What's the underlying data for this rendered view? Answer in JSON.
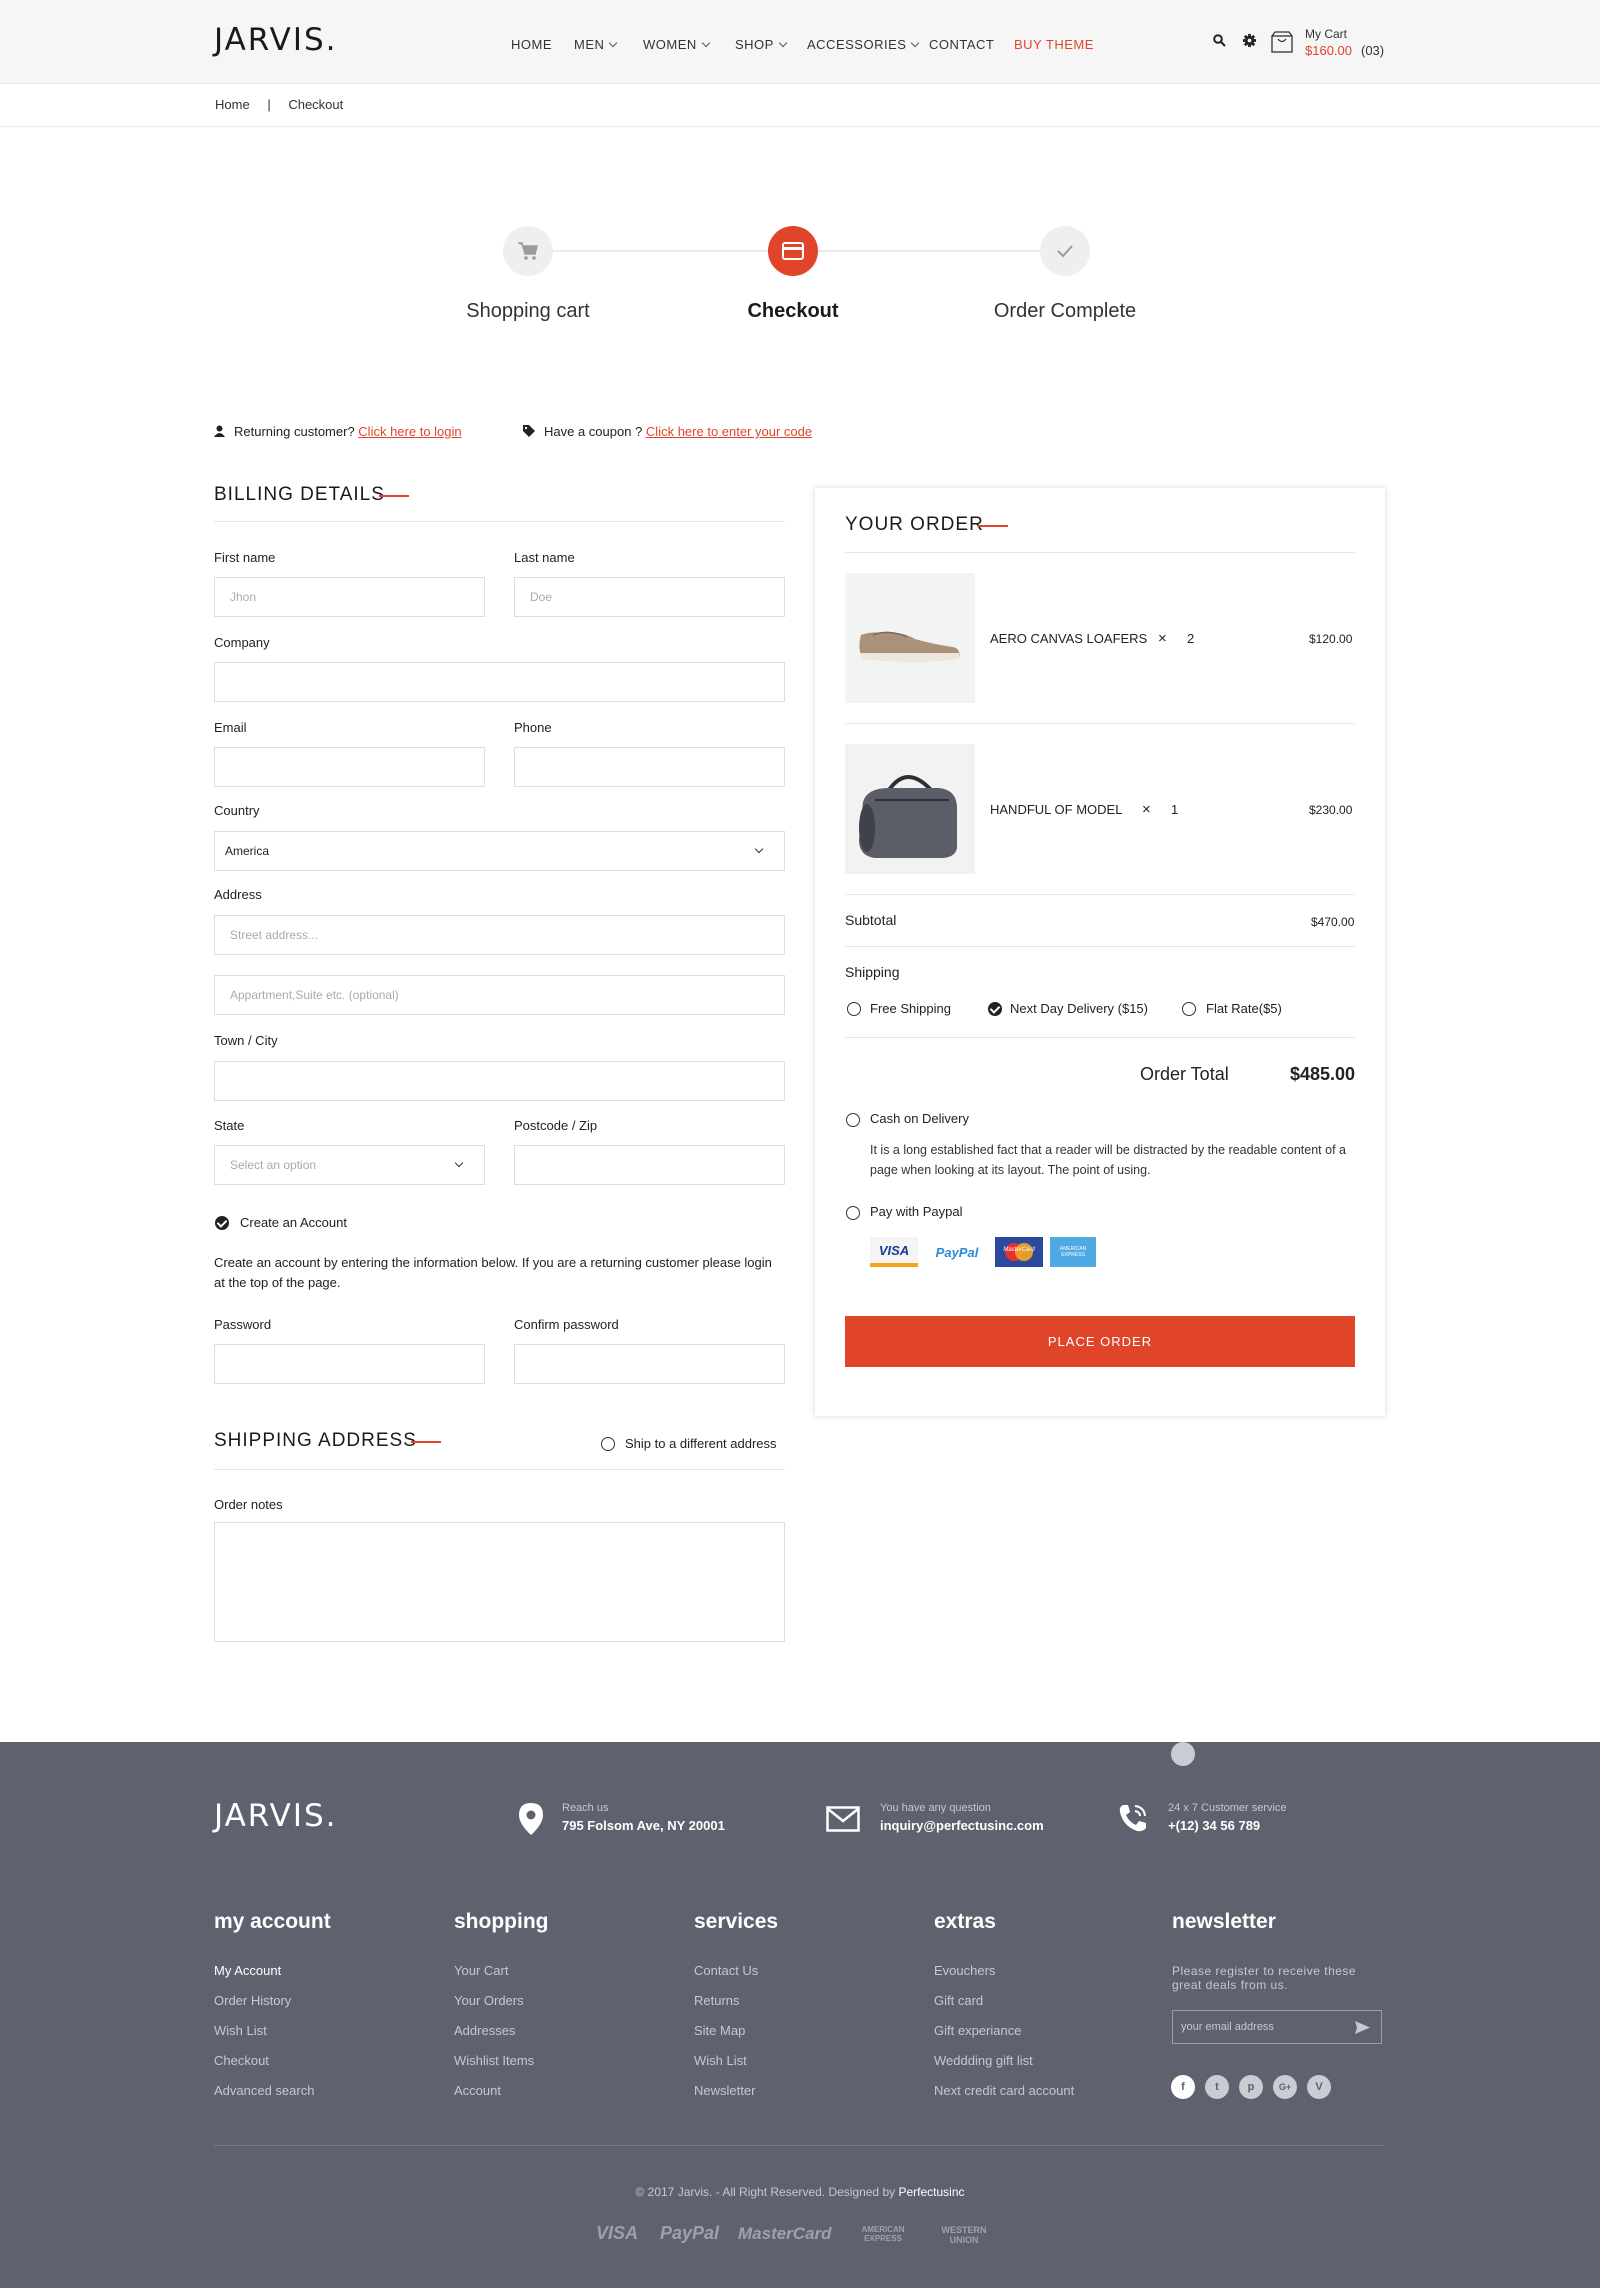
{
  "header": {
    "logo": "JARVIS.",
    "nav": [
      "HOME",
      "MEN",
      "WOMEN",
      "SHOP",
      "ACCESSORIES",
      "CONTACT",
      "BUY THEME"
    ],
    "cart_label": "My Cart",
    "cart_amount": "$160.00",
    "cart_count": "(03)"
  },
  "breadcrumb": {
    "home": "Home",
    "sep": "|",
    "current": "Checkout"
  },
  "steps": [
    "Shopping cart",
    "Checkout",
    "Order Complete"
  ],
  "notices": {
    "returning": "Returning customer?",
    "login_link": "Click here to login",
    "coupon": "Have a coupon ?",
    "coupon_link": "Click here to enter your code"
  },
  "billing": {
    "title": "BILLING DETAILS",
    "first_name_label": "First name",
    "first_name_placeholder": "Jhon",
    "last_name_label": "Last name",
    "last_name_placeholder": "Doe",
    "company_label": "Company",
    "email_label": "Email",
    "phone_label": "Phone",
    "country_label": "Country",
    "country_value": "America",
    "address_label": "Address",
    "street_placeholder": "Street address...",
    "apt_placeholder": "Appartment,Suite etc. (optional)",
    "town_label": "Town / City",
    "state_label": "State",
    "state_placeholder": "Select an option",
    "postcode_label": "Postcode / Zip",
    "create_account": "Create an Account",
    "create_account_desc": "Create an account by entering the information below. If you are a returning customer please login at the top of the page.",
    "password_label": "Password",
    "confirm_password_label": "Confirm password"
  },
  "shipping_address": {
    "title": "SHIPPING ADDRESS",
    "ship_different": "Ship to a different address",
    "notes_label": "Order notes"
  },
  "order": {
    "title": "YOUR ORDER",
    "items": [
      {
        "name": "AERO CANVAS LOAFERS",
        "times": "×",
        "qty": "2",
        "price": "$120.00"
      },
      {
        "name": "HANDFUL OF MODEL",
        "times": "×",
        "qty": "1",
        "price": "$230.00"
      }
    ],
    "subtotal_label": "Subtotal",
    "subtotal_value": "$470.00",
    "shipping_label": "Shipping",
    "shipping_options": [
      "Free Shipping",
      "Next Day Delivery ($15)",
      "Flat Rate($5)"
    ],
    "total_label": "Order Total",
    "total_value": "$485.00",
    "cod_label": "Cash on Delivery",
    "cod_desc": "It is a long established fact that a reader will be distracted by the readable content of a page when looking at its layout. The point of using.",
    "paypal_label": "Pay with Paypal",
    "cards": [
      "VISA",
      "PayPal",
      "MasterCard",
      "AMERICAN EXPRESS"
    ],
    "place_order": "PLACE ORDER"
  },
  "footer": {
    "logo": "JARVIS.",
    "reach_label": "Reach us",
    "reach_value": "795 Folsom Ave, NY 20001",
    "question_label": "You have any question",
    "question_value": "inquiry@perfectusinc.com",
    "service_label": "24 x 7 Customer service",
    "service_value": "+(12) 34 56 789",
    "columns": [
      {
        "title": "my account",
        "items": [
          "My Account",
          "Order History",
          "Wish List",
          "Checkout",
          "Advanced search"
        ]
      },
      {
        "title": "shopping",
        "items": [
          "Your Cart",
          "Your Orders",
          "Addresses",
          "Wishlist Items",
          "Account"
        ]
      },
      {
        "title": "services",
        "items": [
          "Contact Us",
          "Returns",
          "Site Map",
          "Wish List",
          "Newsletter"
        ]
      },
      {
        "title": "extras",
        "items": [
          "Evouchers",
          "Gift card",
          "Gift experiance",
          "Weddding gift list",
          "Next credit card account"
        ]
      }
    ],
    "newsletter_title": "newsletter",
    "newsletter_desc": "Please register to receive these great deals from us.",
    "newsletter_placeholder": "your email address",
    "copyright": "© 2017 Jarvis. -  All Right Reserved. Designed by",
    "designer": "Perfectusinc",
    "payments": [
      "VISA",
      "PayPal",
      "MasterCard",
      "AMERICAN EXPRESS",
      "WESTERN UNION"
    ]
  },
  "colors": {
    "accent": "#e0452a",
    "footer_bg": "#5e626e"
  }
}
